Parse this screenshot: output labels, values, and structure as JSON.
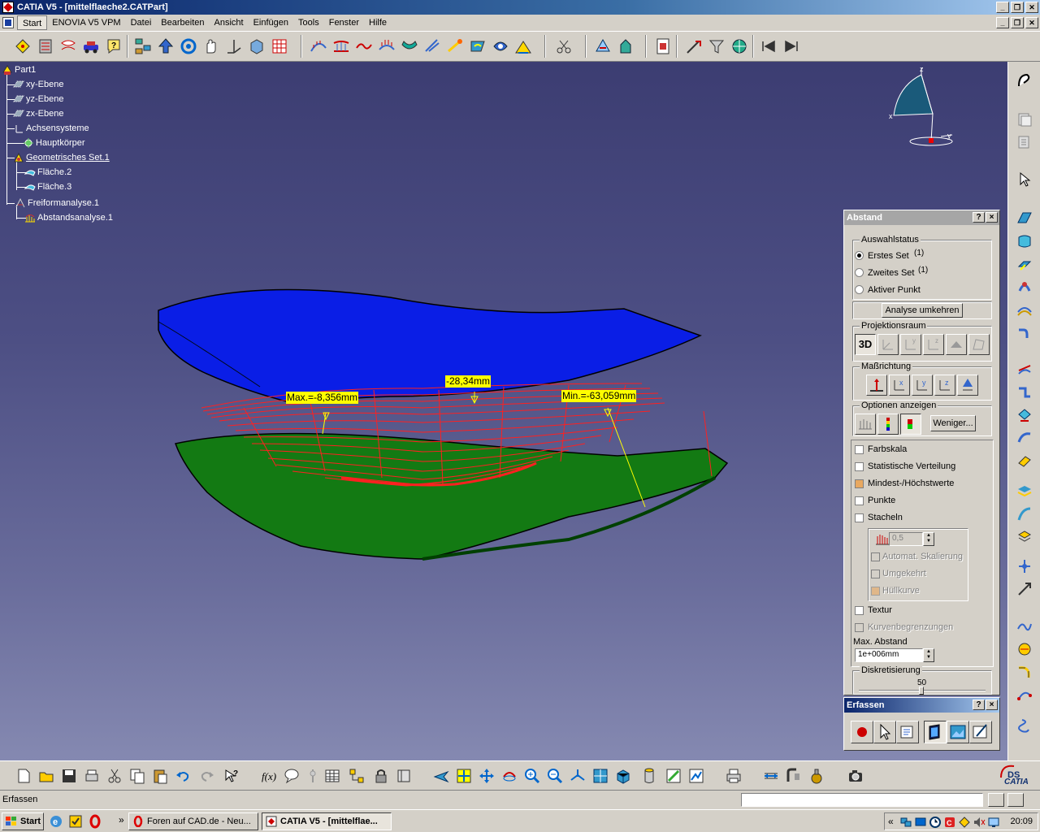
{
  "window": {
    "title": "CATIA V5 - [mittelflaeche2.CATPart]"
  },
  "menubar": {
    "items": [
      "Start",
      "ENOVIA V5 VPM",
      "Datei",
      "Bearbeiten",
      "Ansicht",
      "Einfügen",
      "Tools",
      "Fenster",
      "Hilfe"
    ]
  },
  "tree": {
    "items": [
      {
        "label": "Part1",
        "icon": "part-icon"
      },
      {
        "label": "xy-Ebene",
        "icon": "plane-icon"
      },
      {
        "label": "yz-Ebene",
        "icon": "plane-icon"
      },
      {
        "label": "zx-Ebene",
        "icon": "plane-icon"
      },
      {
        "label": "Achsensysteme",
        "icon": "axis-system-icon"
      },
      {
        "label": "Hauptkörper",
        "icon": "body-icon"
      },
      {
        "label": "Geometrisches Set.1",
        "icon": "geometric-set-icon"
      },
      {
        "label": "Fläche.2",
        "icon": "surface-icon"
      },
      {
        "label": "Fläche.3",
        "icon": "surface-icon"
      },
      {
        "label": "Freiformanalyse.1",
        "icon": "freeform-analysis-icon"
      },
      {
        "label": "Abstandsanalyse.1",
        "icon": "distance-analysis-icon"
      }
    ]
  },
  "viewport": {
    "annotations": {
      "max": "Max.=-8,356mm",
      "mid": "-28,34mm",
      "min": "Min.=-63,059mm"
    },
    "colors": {
      "upper_surface": "#0a1ee6",
      "lower_surface": "#137a13",
      "spikes": "#ff2020",
      "annotation_bg": "#ffff00"
    }
  },
  "abstand": {
    "title": "Abstand",
    "help": "?",
    "close": "×",
    "auswahlstatus_label": "Auswahlstatus",
    "radio_erstes": "Erstes Set",
    "radio_erstes_count": "(1)",
    "radio_zweites": "Zweites Set",
    "radio_zweites_count": "(1)",
    "radio_aktiver": "Aktiver Punkt",
    "analyse_umkehren": "Analyse umkehren",
    "projektionsraum_label": "Projektionsraum",
    "projektion_3d": "3D",
    "massrichtung_label": "Maßrichtung",
    "optionen_label": "Optionen anzeigen",
    "weniger": "Weniger...",
    "farbskala": "Farbskala",
    "statistische_verteilung": "Statistische Verteilung",
    "mindest_hoechst": "Mindest-/Höchstwerte",
    "punkte": "Punkte",
    "stacheln": "Stacheln",
    "stacheln_value": "0,5",
    "automat_skalierung": "Automat. Skalierung",
    "umgekehrt": "Umgekehrt",
    "huellkurve": "Hüllkurve",
    "textur": "Textur",
    "kurvenbegrenzungen": "Kurvenbegrenzungen",
    "max_abstand_label": "Max. Abstand",
    "max_abstand_value": "1e+006mm",
    "diskretisierung_label": "Diskretisierung",
    "diskretisierung_value": "50"
  },
  "erfassen": {
    "title": "Erfassen",
    "help": "?",
    "close": "×"
  },
  "status": {
    "text": "Erfassen"
  },
  "taskbar": {
    "start": "Start",
    "tasks": [
      "Foren auf CAD.de - Neu...",
      "CATIA V5 - [mittelflae..."
    ],
    "chevron": "»",
    "tray_chevron": "«",
    "clock": "20:09"
  },
  "brand": {
    "catia": "CATIA",
    "ds": "DS"
  }
}
